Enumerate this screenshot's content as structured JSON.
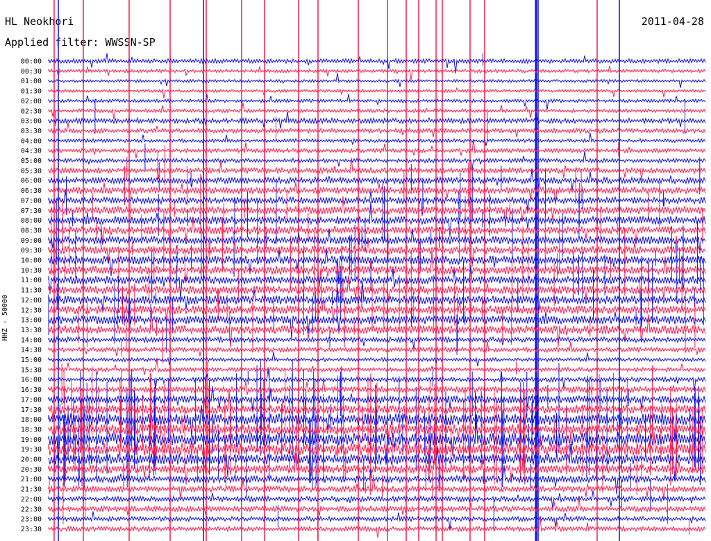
{
  "header": {
    "station": "HL Neokhori",
    "date": "2011-04-28",
    "filter": "Applied filter: WWSSN-SP"
  },
  "chart_data": {
    "type": "line",
    "title": "HL Neokhori",
    "subtitle": "Applied filter: WWSSN-SP",
    "ylabel": "HHZ - 50000",
    "y_tick_labels": [
      "00:00",
      "00:30",
      "01:00",
      "01:30",
      "02:00",
      "02:30",
      "03:00",
      "03:30",
      "04:00",
      "04:30",
      "05:00",
      "05:30",
      "06:00",
      "06:30",
      "07:00",
      "07:30",
      "08:00",
      "08:30",
      "09:00",
      "09:30",
      "10:00",
      "10:30",
      "11:00",
      "11:30",
      "12:00",
      "12:30",
      "13:00",
      "13:30",
      "14:00",
      "14:30",
      "15:00",
      "15:30",
      "16:00",
      "16:30",
      "17:00",
      "17:30",
      "18:00",
      "18:30",
      "19:00",
      "19:30",
      "20:00",
      "20:30",
      "21:00",
      "21:30",
      "22:00",
      "22:30",
      "23:00",
      "23:30"
    ],
    "series_colors": [
      "#1010e0",
      "#ff1a4b"
    ],
    "activity_levels": [
      0.22,
      0.12,
      0.08,
      0.08,
      0.12,
      0.14,
      0.28,
      0.24,
      0.14,
      0.2,
      0.2,
      0.3,
      0.38,
      0.4,
      0.42,
      0.5,
      0.55,
      0.5,
      0.55,
      0.55,
      0.6,
      0.6,
      0.55,
      0.55,
      0.6,
      0.6,
      0.6,
      0.6,
      0.3,
      0.25,
      0.15,
      0.2,
      0.25,
      0.35,
      0.5,
      0.6,
      0.9,
      0.8,
      1.0,
      1.0,
      0.8,
      0.6,
      0.45,
      0.35,
      0.3,
      0.3,
      0.25,
      0.25
    ],
    "grid": false
  }
}
